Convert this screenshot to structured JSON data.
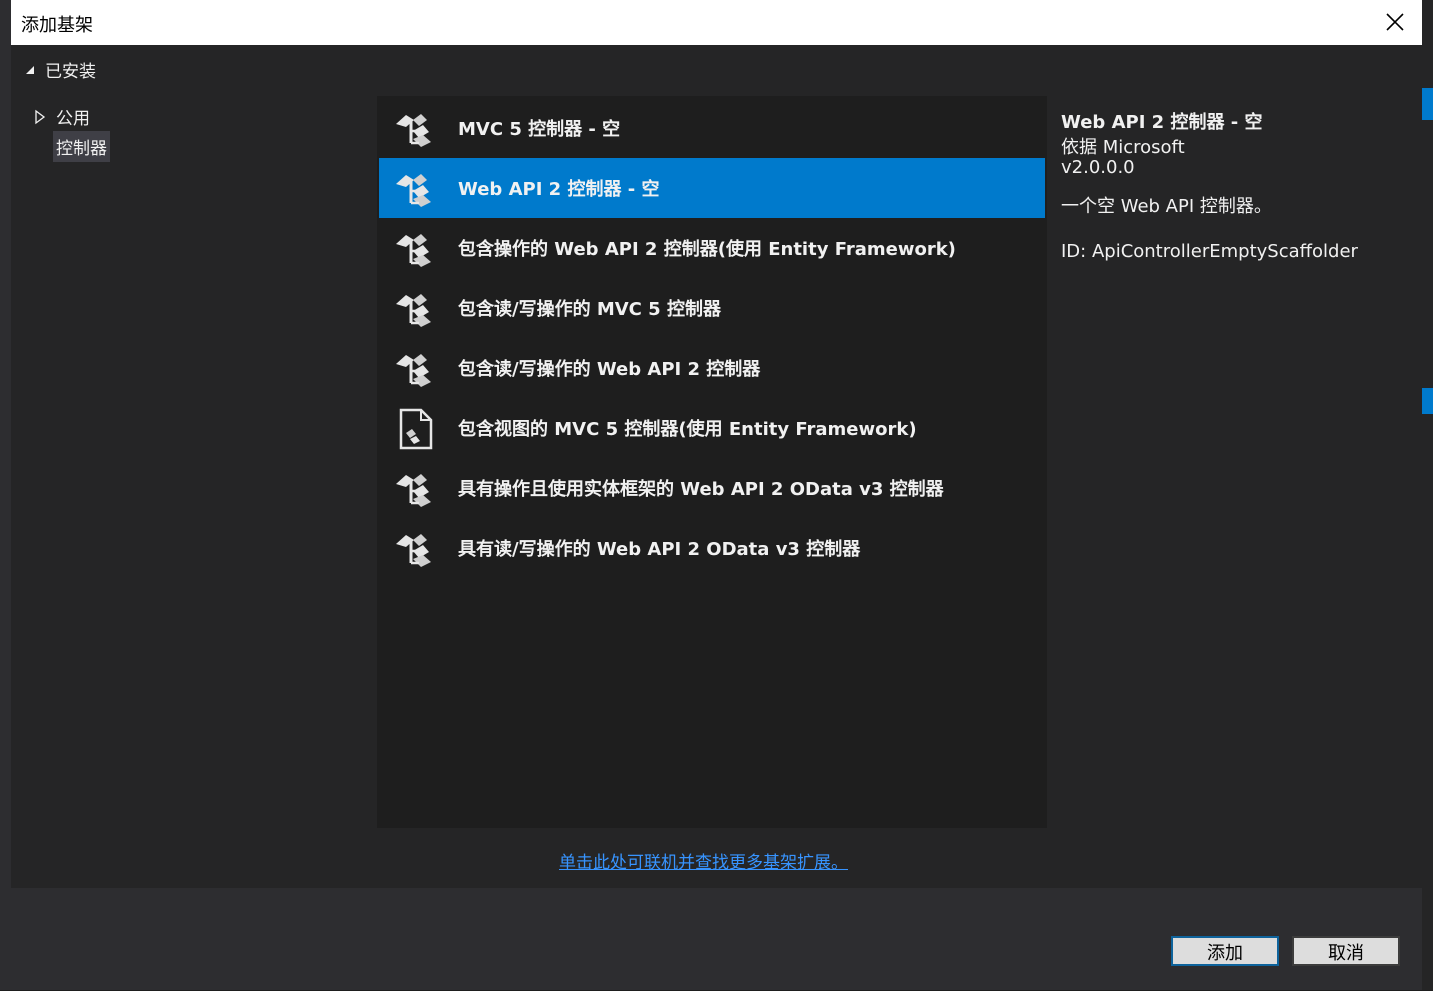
{
  "dialog": {
    "title": "添加基架",
    "tree": {
      "root_label": "已安装",
      "children": [
        {
          "label": "公用"
        },
        {
          "label": "控制器"
        }
      ]
    },
    "scaffolders": [
      {
        "label": "MVC 5 控制器 - 空",
        "icon": "controller-icon"
      },
      {
        "label": "Web API 2 控制器 - 空",
        "icon": "controller-icon"
      },
      {
        "label": "包含操作的 Web API 2 控制器(使用 Entity Framework)",
        "icon": "controller-icon"
      },
      {
        "label": "包含读/写操作的 MVC 5 控制器",
        "icon": "controller-icon"
      },
      {
        "label": "包含读/写操作的 Web API 2 控制器",
        "icon": "controller-icon"
      },
      {
        "label": "包含视图的 MVC 5 控制器(使用 Entity Framework)",
        "icon": "view-controller-icon"
      },
      {
        "label": "具有操作且使用实体框架的 Web API 2 OData v3 控制器",
        "icon": "controller-icon"
      },
      {
        "label": "具有读/写操作的 Web API 2 OData v3 控制器",
        "icon": "controller-icon"
      }
    ],
    "selected_index": 1,
    "details": {
      "title": "Web API 2 控制器 - 空",
      "author": "依据 Microsoft",
      "version": "v2.0.0.0",
      "description": "一个空 Web API 控制器。",
      "id": "ID: ApiControllerEmptyScaffolder"
    },
    "online_link": "单击此处可联机并查找更多基架扩展。",
    "buttons": {
      "add": "添加",
      "cancel": "取消"
    },
    "colors": {
      "accent": "#007acc",
      "link": "#3794ff"
    }
  }
}
